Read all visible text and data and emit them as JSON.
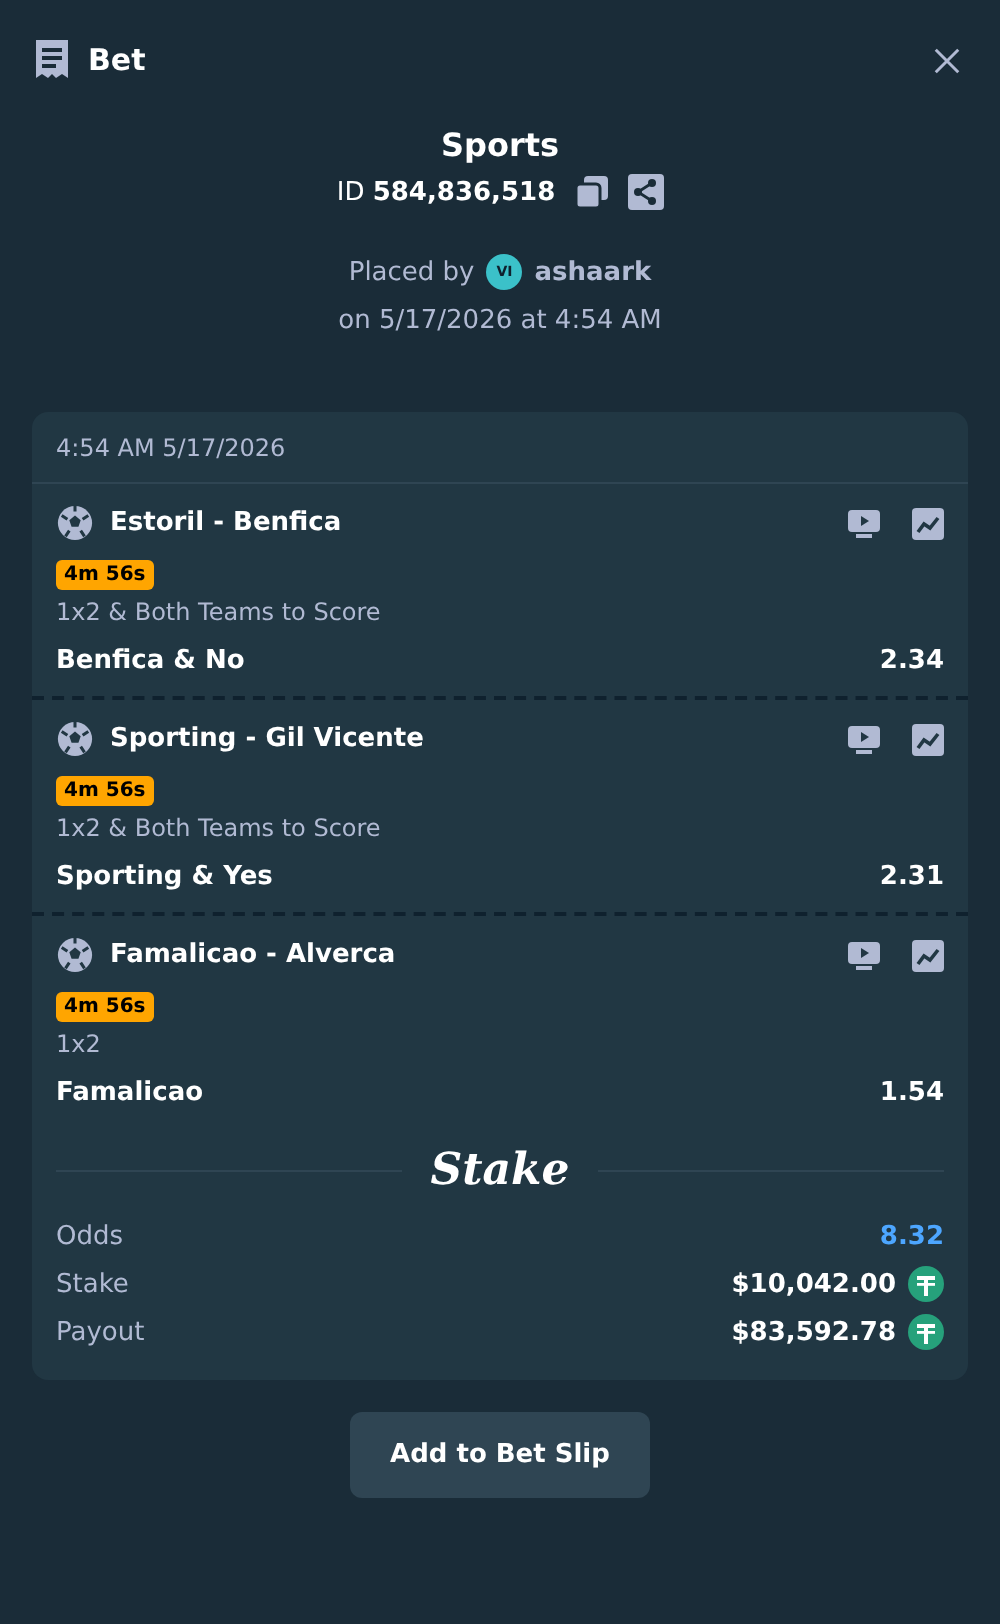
{
  "header": {
    "title": "Bet"
  },
  "summary": {
    "category": "Sports",
    "bet_id": "ID **584,836,518**",
    "placed_by": "Placed by",
    "vip_badge": "VI",
    "user": "ashaark",
    "placed_on": "on 5/17/2026 at 4:54 AM"
  },
  "card": {
    "timestamp": "4:54 AM 5/17/2026",
    "legs": [
      {
        "match": "Estoril - Benfica",
        "timer": "4m 56s",
        "market": "1x2 & Both Teams to Score",
        "selection": "Benfica & No",
        "odds": "2.34"
      },
      {
        "match": "Sporting - Gil Vicente",
        "timer": "4m 56s",
        "market": "1x2 & Both Teams to Score",
        "selection": "Sporting & Yes",
        "odds": "2.31"
      },
      {
        "match": "Famalicao - Alverca",
        "timer": "4m 56s",
        "market": "1x2",
        "selection": "Famalicao",
        "odds": "1.54"
      }
    ],
    "brand": "Stake",
    "totals": [
      {
        "kind": "odds",
        "label": "Odds",
        "value": "8.32"
      },
      {
        "kind": "amount",
        "label": "Stake",
        "value": "$10,042.00"
      },
      {
        "kind": "amount",
        "label": "Payout",
        "value": "$83,592.78"
      }
    ]
  },
  "button": "Add to Bet Slip"
}
